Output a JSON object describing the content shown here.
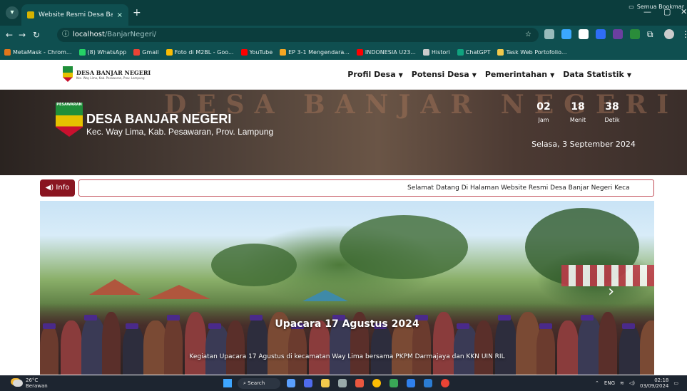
{
  "browser": {
    "tab_title": "Website Resmi Desa Banjar Nec",
    "tab_close": "×",
    "new_tab": "+",
    "url_host": "localhost",
    "url_path": "/BanjarNegeri/",
    "bookmarks": [
      {
        "label": "MetaMask - Chrom...",
        "color": "#e2761b"
      },
      {
        "label": "(8) WhatsApp",
        "color": "#25d366"
      },
      {
        "label": "Gmail",
        "color": "#ea4335"
      },
      {
        "label": "Foto di M2BL - Goo...",
        "color": "#fbbc04"
      },
      {
        "label": "YouTube",
        "color": "#ff0000"
      },
      {
        "label": "EP 3-1 Mengendara...",
        "color": "#f5a623"
      },
      {
        "label": "INDONESIA U23...",
        "color": "#ff0000"
      },
      {
        "label": "Histori",
        "color": "#cccccc"
      },
      {
        "label": "ChatGPT",
        "color": "#10a37f"
      },
      {
        "label": "Task Web Portofolio...",
        "color": "#f2c94c"
      }
    ],
    "bookmarks_right": "Semua Bookmar"
  },
  "site": {
    "brand_name": "DESA BANJAR NEGERI",
    "brand_sub": "Kec. Way Lima, Kab. Pesawaran, Prov. Lampung",
    "menu": [
      {
        "label": "Profil Desa"
      },
      {
        "label": "Potensi Desa"
      },
      {
        "label": "Pemerintahan"
      },
      {
        "label": "Data Statistik"
      }
    ]
  },
  "hero": {
    "bg_text": "DESA BANJAR NEGERI",
    "logo_label": "PESAWARAN",
    "title": "DESA BANJAR NEGERI",
    "subtitle": "Kec. Way Lima, Kab. Pesawaran, Prov. Lampung",
    "clock": [
      {
        "value": "02",
        "label": "Jam"
      },
      {
        "value": "18",
        "label": "Menit"
      },
      {
        "value": "38",
        "label": "Detik"
      }
    ],
    "date": "Selasa, 3 September 2024"
  },
  "info": {
    "badge": "Info",
    "ticker": "Selamat Datang Di Halaman Website Resmi Desa Banjar Negeri Keca"
  },
  "carousel": {
    "title": "Upacara 17 Agustus 2024",
    "caption": "Kegiatan Upacara 17 Agustus di kecamatan Way Lima bersama PKPM Darmajaya dan KKN UIN RIL"
  },
  "taskbar": {
    "temp": "26°C",
    "weather": "Berawan",
    "search": "Search",
    "lang": "ENG",
    "time": "02:18",
    "date": "03/09/2024"
  }
}
